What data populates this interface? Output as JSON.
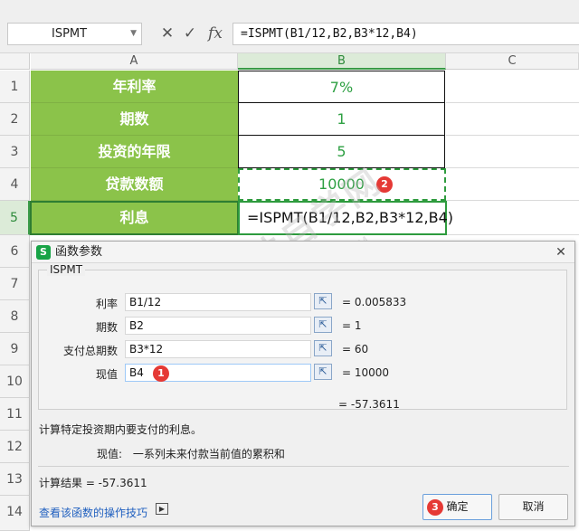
{
  "formula_bar": {
    "name_box": "ISPMT",
    "cancel_icon": "✕",
    "accept_icon": "✓",
    "fx_label": "fx",
    "formula": "=ISPMT(B1/12,B2,B3*12,B4)"
  },
  "columns": [
    "A",
    "B",
    "C"
  ],
  "rows": [
    "1",
    "2",
    "3",
    "4",
    "5",
    "6",
    "7",
    "8",
    "9",
    "10",
    "11",
    "12",
    "13",
    "14"
  ],
  "cells": [
    {
      "label": "年利率",
      "value": "7%"
    },
    {
      "label": "期数",
      "value": "1"
    },
    {
      "label": "投资的年限",
      "value": "5"
    },
    {
      "label": "贷款数额",
      "value": "10000"
    },
    {
      "label": "利息",
      "value": "=ISPMT(B1/12,B2,B3*12,B4)"
    }
  ],
  "badges": {
    "one": "1",
    "two": "2",
    "three": "3"
  },
  "dialog": {
    "title": "函数参数",
    "logo": "S",
    "close": "✕",
    "function_name": "ISPMT",
    "params": [
      {
        "label": "利率",
        "value": "B1/12",
        "result": "= 0.005833"
      },
      {
        "label": "期数",
        "value": "B2",
        "result": "= 1"
      },
      {
        "label": "支付总期数",
        "value": "B3*12",
        "result": "= 60"
      },
      {
        "label": "现值",
        "value": "B4",
        "result": "= 10000"
      }
    ],
    "total": "= -57.3611",
    "description": "计算特定投资期内要支付的利息。",
    "param_desc_label": "现值:",
    "param_desc_text": "一系列未来付款当前值的累积和",
    "calc_result": "计算结果 = -57.3611",
    "help_link": "查看该函数的操作技巧",
    "ok": "确定",
    "cancel": "取消"
  },
  "watermark": {
    "big": "软件自学网",
    "small": "WWW.RJZXW.COM"
  }
}
